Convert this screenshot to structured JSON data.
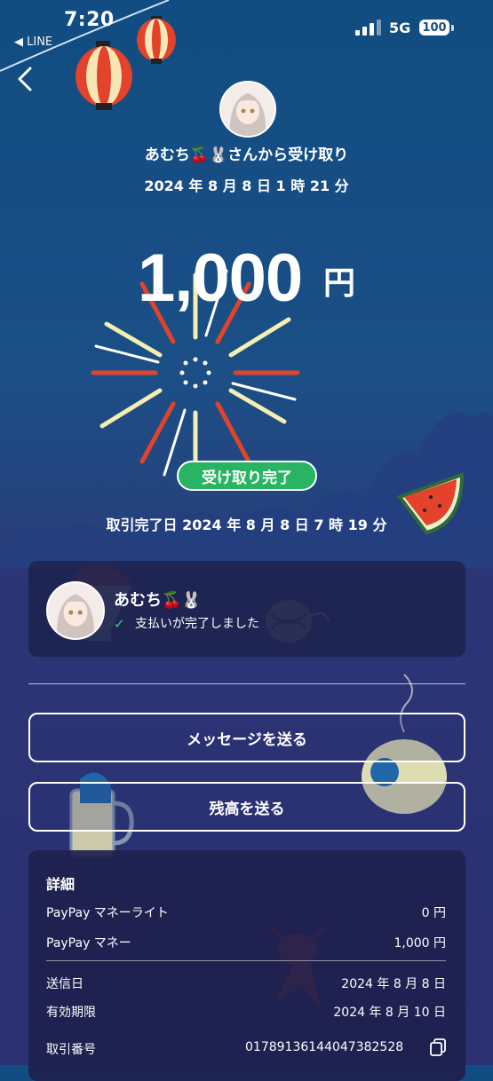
{
  "status_bar": {
    "time": "7:20",
    "back_app": "◀ LINE",
    "network": "5G",
    "battery": "100"
  },
  "header": {
    "from_text": "あむち🍒🐰さんから受け取り",
    "date_text": "2024 年 8 月 8 日 1 時 21 分"
  },
  "amount": {
    "value": "1,000",
    "unit": "円"
  },
  "status_badge": "受け取り完了",
  "completed_text": "取引完了日 2024 年 8 月 8 日 7 時 19 分",
  "payer_card": {
    "name": "あむち🍒🐰",
    "check": "✓",
    "status": "支払いが完了しました"
  },
  "buttons": {
    "send_message": "メッセージを送る",
    "send_balance": "残高を送る"
  },
  "details": {
    "title": "詳細",
    "lite_label": "PayPay マネーライト",
    "lite_value": "0 円",
    "money_label": "PayPay マネー",
    "money_value": "1,000 円",
    "sent_label": "送信日",
    "sent_value": "2024 年 8 月 8 日",
    "expiry_label": "有効期限",
    "expiry_value": "2024 年 8 月 10 日",
    "txn_label": "取引番号",
    "txn_value": "01789136144047382528"
  },
  "colors": {
    "accent_green": "#28b463",
    "bg_top": "#114d82",
    "bg_bottom": "#2b3072"
  }
}
